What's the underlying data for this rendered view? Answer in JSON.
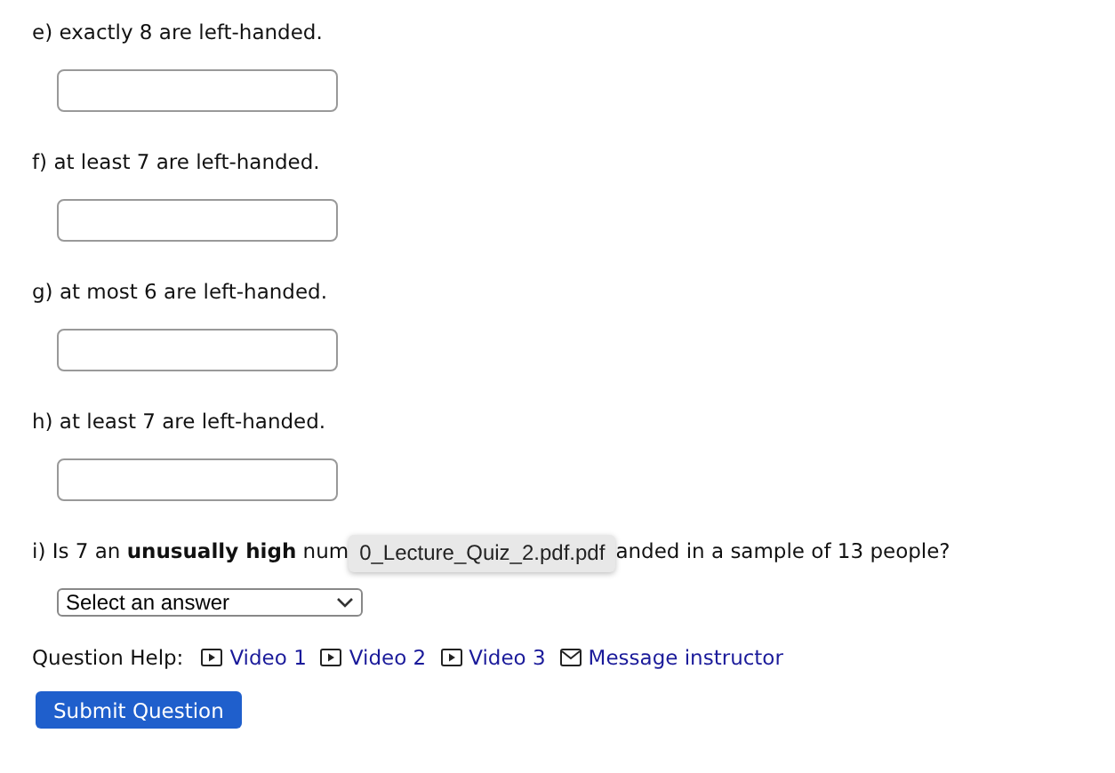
{
  "parts": [
    {
      "label": "e) exactly 8 are left-handed."
    },
    {
      "label": "f) at least 7 are left-handed."
    },
    {
      "label": "g) at most 6 are left-handed."
    },
    {
      "label": "h) at least 7 are left-handed."
    }
  ],
  "question_i": {
    "text_before": "i) Is 7 an **unusually high** num",
    "tooltip": "0_Lecture_Quiz_2.pdf.pdf",
    "text_after": "anded in a sample of 13 people?",
    "select": "Select an answer"
  },
  "help": {
    "label": "Question Help:",
    "links": [
      {
        "kind": "video",
        "label": "Video 1"
      },
      {
        "kind": "video",
        "label": "Video 2"
      },
      {
        "kind": "video",
        "label": "Video 3"
      },
      {
        "kind": "message",
        "label": "Message instructor"
      }
    ]
  },
  "submit": "Submit Question"
}
